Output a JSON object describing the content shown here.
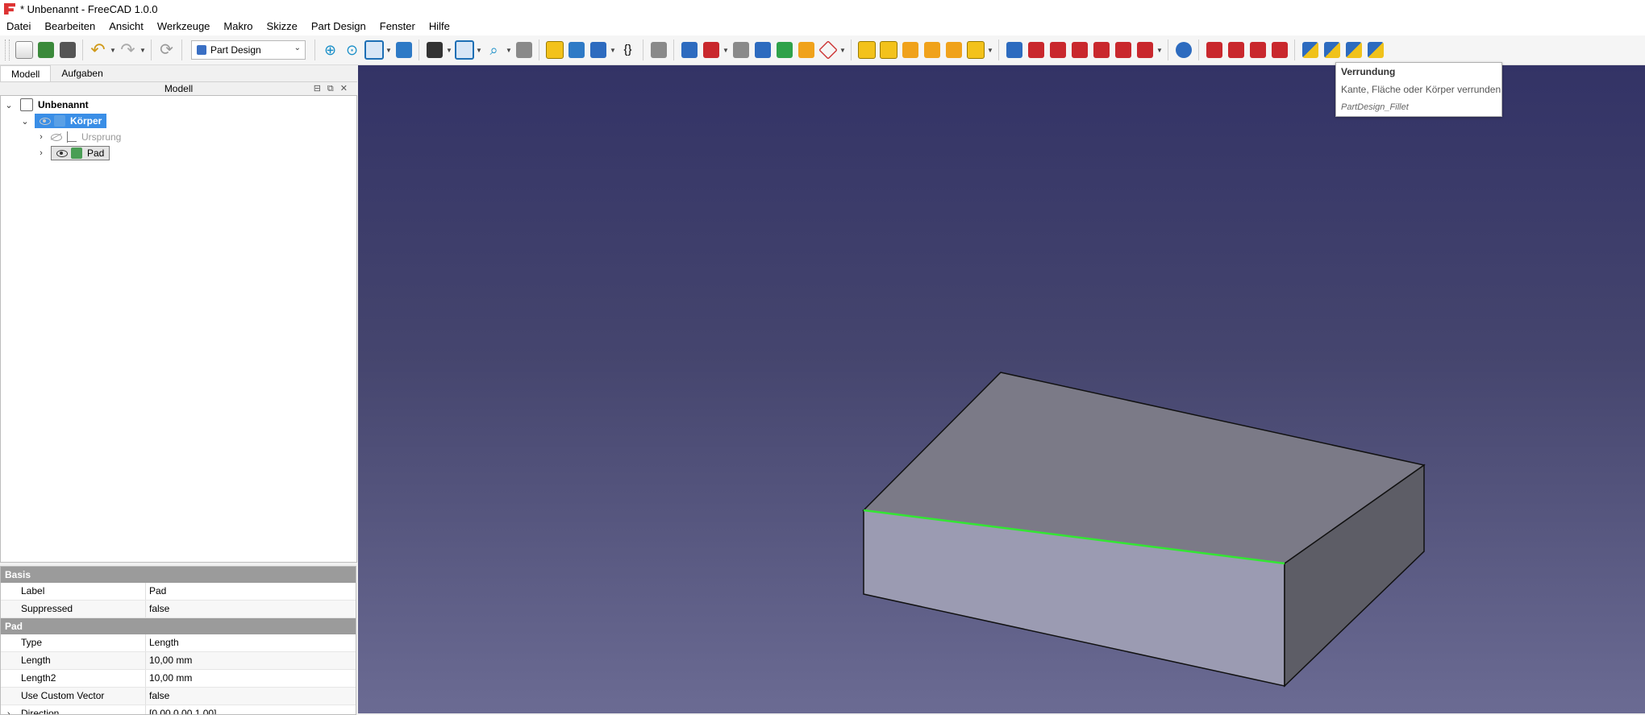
{
  "window": {
    "title": "* Unbenannt - FreeCAD 1.0.0"
  },
  "menu": [
    "Datei",
    "Bearbeiten",
    "Ansicht",
    "Werkzeuge",
    "Makro",
    "Skizze",
    "Part Design",
    "Fenster",
    "Hilfe"
  ],
  "toolbar": {
    "workbench": "Part Design"
  },
  "left_panel": {
    "tabs": [
      "Modell",
      "Aufgaben"
    ],
    "active_tab": "Modell",
    "dock_title": "Modell",
    "tree": {
      "document": "Unbenannt",
      "body": "Körper",
      "origin": "Ursprung",
      "pad": "Pad"
    }
  },
  "properties": {
    "groups": [
      {
        "name": "Basis",
        "rows": [
          {
            "name": "Label",
            "value": "Pad"
          },
          {
            "name": "Suppressed",
            "value": "false"
          }
        ]
      },
      {
        "name": "Pad",
        "rows": [
          {
            "name": "Type",
            "value": "Length"
          },
          {
            "name": "Length",
            "value": "10,00 mm"
          },
          {
            "name": "Length2",
            "value": "10,00 mm"
          },
          {
            "name": "Use Custom Vector",
            "value": "false"
          },
          {
            "name": "Direction",
            "value": "[0,00 0,00 1,00]"
          }
        ]
      }
    ]
  },
  "tooltip": {
    "title": "Verrundung",
    "description": "Kante, Fläche oder Körper verrunden",
    "command": "PartDesign_Fillet"
  },
  "colors": {
    "view_top": "#333366",
    "view_bottom": "#6b6b93",
    "selection_highlight": "#3a8ee6",
    "selected_edge": "#33e633",
    "box_top": "#7b7a87",
    "box_front": "#9b9bb2",
    "box_side": "#5d5d66"
  }
}
